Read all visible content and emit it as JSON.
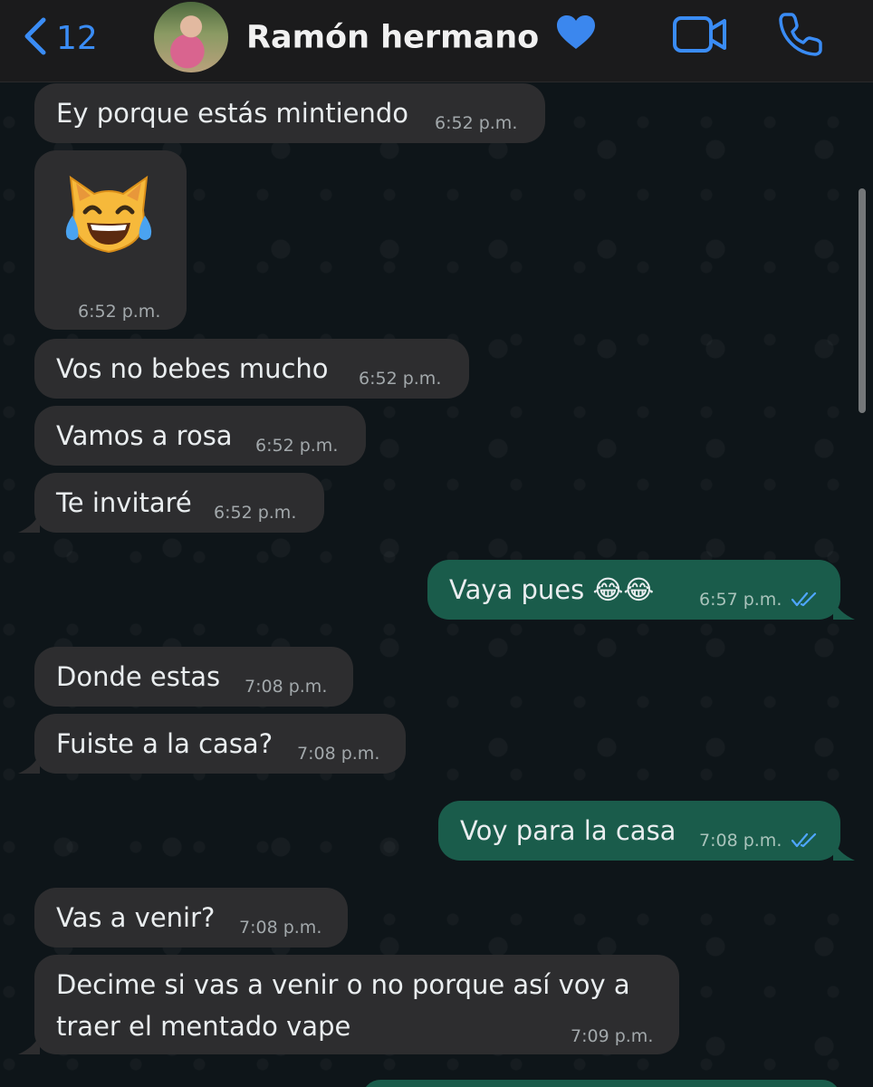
{
  "header": {
    "back_count": "12",
    "contact_name": "Ramón hermano",
    "icons": {
      "back": "chevron-left-icon",
      "heart": "blue-heart-emoji",
      "video": "video-camera-icon",
      "call": "phone-icon"
    }
  },
  "colors": {
    "accent": "#3a8cf5",
    "incoming_bubble": "#2d2d2f",
    "outgoing_bubble": "#1a5c4b",
    "read_ticks": "#4fa6ff"
  },
  "messages": [
    {
      "dir": "in",
      "text": "Ey porque estás mintiendo",
      "time": "6:52 p.m."
    },
    {
      "dir": "in",
      "emoji": "cat-with-tears-of-joy-emoji",
      "time": "6:52 p.m."
    },
    {
      "dir": "in",
      "text": "Vos no bebes mucho",
      "time": "6:52 p.m."
    },
    {
      "dir": "in",
      "text": "Vamos a rosa",
      "time": "6:52 p.m."
    },
    {
      "dir": "in",
      "text": "Te invitaré",
      "time": "6:52 p.m."
    },
    {
      "dir": "out",
      "text": "Vaya pues 😂😂",
      "time": "6:57 p.m.",
      "status": "read"
    },
    {
      "dir": "in",
      "text": "Donde estas",
      "time": "7:08 p.m."
    },
    {
      "dir": "in",
      "text": "Fuiste a la casa?",
      "time": "7:08 p.m."
    },
    {
      "dir": "out",
      "text": "Voy para la casa",
      "time": "7:08 p.m.",
      "status": "read"
    },
    {
      "dir": "in",
      "text": "Vas a venir?",
      "time": "7:08 p.m."
    },
    {
      "dir": "in",
      "text": "Decime si vas a venir o no porque así voy a traer el mentado vape",
      "time": "7:09 p.m."
    }
  ]
}
